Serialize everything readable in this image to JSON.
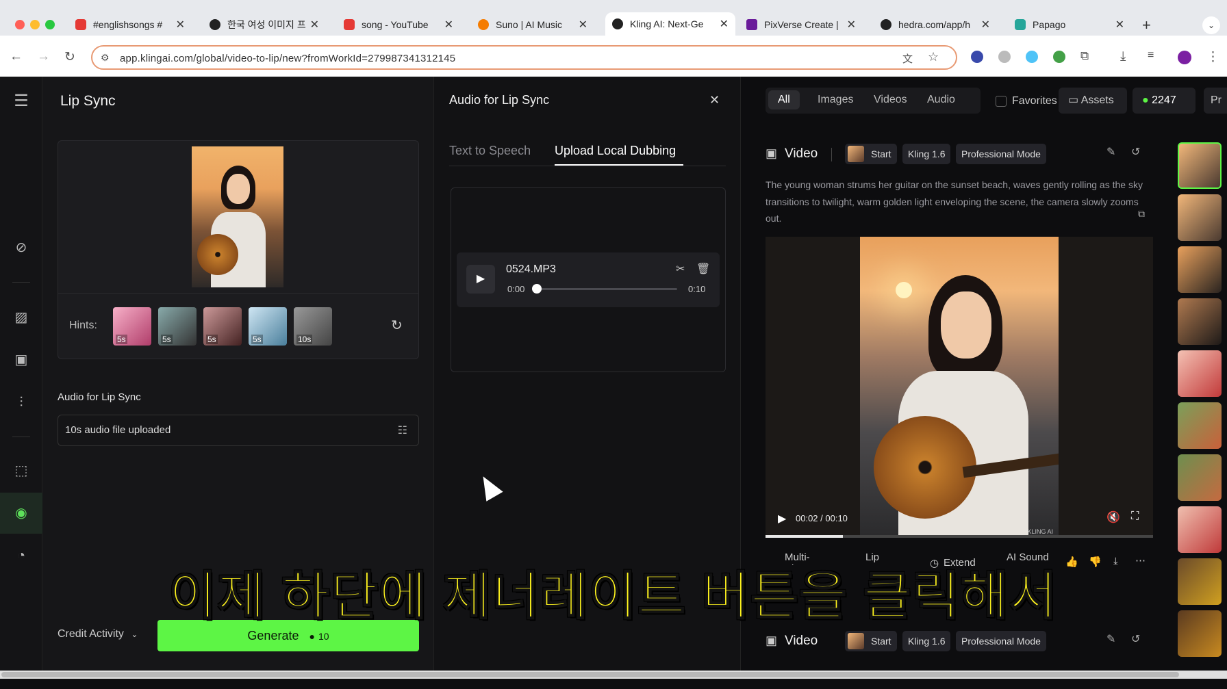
{
  "browser": {
    "tabs": [
      {
        "label": "#englishsongs #",
        "color": "#e53935"
      },
      {
        "label": "한국 여성 이미지 프",
        "color": "#222222"
      },
      {
        "label": "song - YouTube",
        "color": "#e53935"
      },
      {
        "label": "Suno | AI Music",
        "color": "#f57c00"
      },
      {
        "label": "Kling AI: Next-Ge",
        "color": "#222222"
      },
      {
        "label": "PixVerse Create |",
        "color": "#6a1b9a"
      },
      {
        "label": "hedra.com/app/h",
        "color": "#222222"
      },
      {
        "label": "Papago",
        "color": "#26a69a"
      }
    ],
    "new_tab": "+",
    "url": "app.klingai.com/global/video-to-lip/new?fromWorkId=279987341312145"
  },
  "left_panel": {
    "title": "Lip Sync",
    "hints_label": "Hints:",
    "hints": [
      "5s",
      "5s",
      "5s",
      "5s",
      "10s"
    ],
    "audio_section_title": "Audio for Lip Sync",
    "audio_field_value": "10s audio file uploaded",
    "credit_activity": "Credit Activity",
    "generate_label": "Generate",
    "generate_cost": "10"
  },
  "audio_panel": {
    "title": "Audio for Lip Sync",
    "tabs": [
      "Text to Speech",
      "Upload Local Dubbing"
    ],
    "active_tab": "Upload Local Dubbing",
    "file_name": "0524.MP3",
    "time_current": "0:00",
    "time_total": "0:10"
  },
  "right_panel": {
    "filters": [
      "All",
      "Images",
      "Videos",
      "Audio"
    ],
    "active_filter": "All",
    "favorites_label": "Favorites",
    "assets_label": "Assets",
    "credits": "2247",
    "more_label": "Pr",
    "item_type": "Video",
    "chips": [
      "Start",
      "Kling 1.6",
      "Professional Mode"
    ],
    "prompt": "The young woman strums her guitar on the sunset beach, waves gently rolling as the sky transitions to twilight, warm golden light enveloping the scene, the camera slowly zooms out.",
    "video_time": "00:02 / 00:10",
    "video_progress": 0.2,
    "actions": [
      "Multi-Elements",
      "Lip Sync",
      "Extend",
      "AI Sound"
    ],
    "second_item_type": "Video",
    "watermark": "KLING AI"
  },
  "subtitle": "이제 하단에 제너레이트 버튼을 클릭해서",
  "colors": {
    "accent_green": "#5df545",
    "subtitle_yellow": "#fff41d",
    "url_border": "#e89a74"
  }
}
